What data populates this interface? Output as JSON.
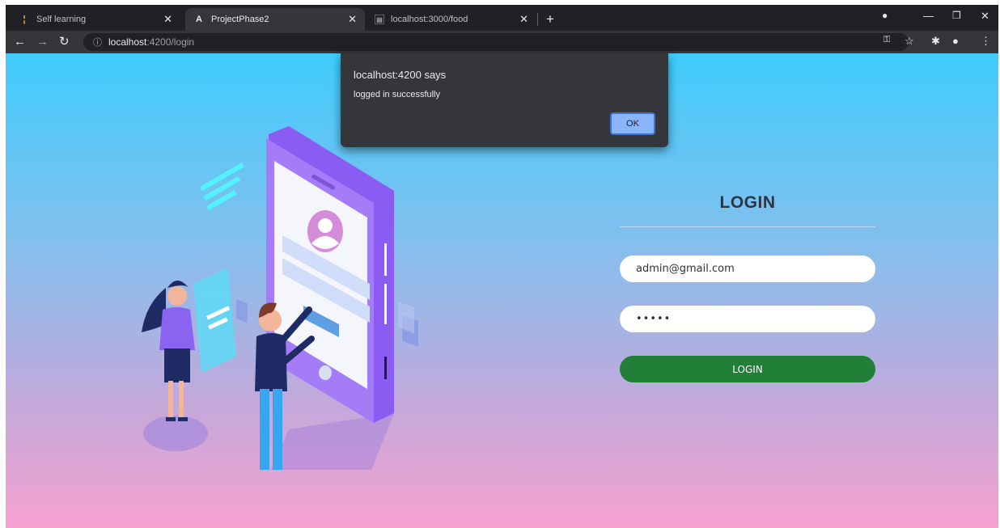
{
  "browser": {
    "tabs": [
      {
        "title": "Self learning",
        "favicon": "self-learning-favicon",
        "state": "inactive"
      },
      {
        "title": "ProjectPhase2",
        "favicon": "angular-favicon",
        "state": "active"
      },
      {
        "title": "localhost:3000/food",
        "favicon": "page-favicon",
        "state": "inactive"
      }
    ],
    "new_tab_label": "+",
    "address": {
      "host": "localhost",
      "path": ":4200/login"
    }
  },
  "dialog": {
    "title": "localhost:4200 says",
    "message": "logged in successfully",
    "ok_label": "OK"
  },
  "login": {
    "title": "LOGIN",
    "email_value": "admin@gmail.com",
    "password_value": "•••••",
    "button_label": "LOGIN"
  },
  "colors": {
    "page_top": "#3fcdfc",
    "page_bottom": "#f6a2cf",
    "login_button": "#217f37",
    "ok_button": "#8ab4f8"
  }
}
